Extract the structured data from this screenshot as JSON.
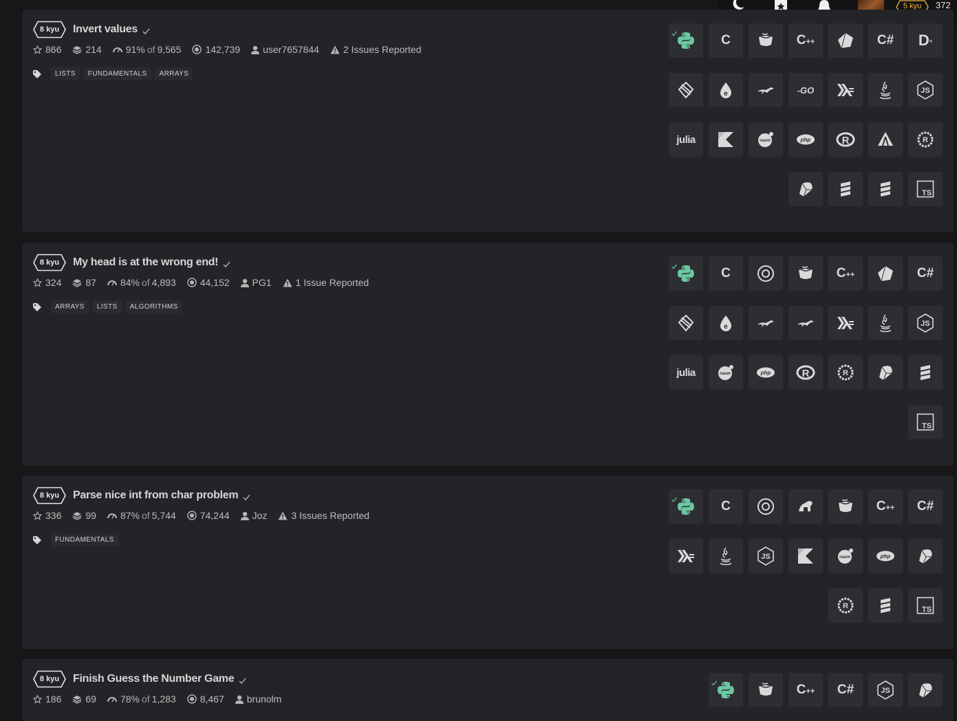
{
  "header": {
    "rank": "5 kyu",
    "honor": "372",
    "icons": [
      "moon-icon",
      "bookmark-icon",
      "bell-icon"
    ]
  },
  "colors": {
    "python": "#6cc7a2",
    "rank": "#e8b83a",
    "card": "#232427",
    "tile": "#2d2e32"
  },
  "katas": [
    {
      "rank": "8 kyu",
      "title": "Invert values",
      "stars": "866",
      "collections": "214",
      "satisfaction": "91%",
      "of": "of",
      "votes": "9,565",
      "completions": "142,739",
      "author": "user7657844",
      "issues": "2 Issues Reported",
      "tags": [
        "LISTS",
        "FUNDAMENTALS",
        "ARRAYS"
      ],
      "languages": [
        "python",
        "c",
        "coffeescript",
        "cpp",
        "crystal",
        "csharp",
        "dart",
        "elixir",
        "elm",
        "factor",
        "go",
        "haskell",
        "java",
        "javascript",
        "julia",
        "kotlin",
        "nasm",
        "php",
        "racket",
        "reason",
        "rust",
        "ruby",
        "scala",
        "solidity",
        "typescript"
      ]
    },
    {
      "rank": "8 kyu",
      "title": "My head is at the wrong end!",
      "stars": "324",
      "collections": "87",
      "satisfaction": "84%",
      "of": "of",
      "votes": "4,893",
      "completions": "44,152",
      "author": "PG1",
      "issues": "1 Issue Reported",
      "tags": [
        "ARRAYS",
        "LISTS",
        "ALGORITHMS"
      ],
      "languages": [
        "python",
        "c",
        "clojure",
        "coffeescript",
        "cpp",
        "crystal",
        "csharp",
        "elixir",
        "elm",
        "factor",
        "factor",
        "haskell",
        "java",
        "javascript",
        "julia",
        "nasm",
        "php",
        "racket",
        "rust",
        "ruby",
        "solidity",
        "typescript"
      ]
    },
    {
      "rank": "8 kyu",
      "title": "Parse nice int from char problem",
      "stars": "336",
      "collections": "99",
      "satisfaction": "87%",
      "of": "of",
      "votes": "5,744",
      "completions": "74,244",
      "author": "Joz",
      "issues": "3 Issues Reported",
      "tags": [
        "FUNDAMENTALS"
      ],
      "languages": [
        "python",
        "c",
        "clojure",
        "cfml",
        "coffeescript",
        "cpp",
        "csharp",
        "haskell",
        "java",
        "javascript",
        "kotlin",
        "nasm",
        "php",
        "ruby",
        "rust",
        "solidity",
        "typescript"
      ]
    },
    {
      "rank": "8 kyu",
      "title": "Finish Guess the Number Game",
      "stars": "186",
      "collections": "69",
      "satisfaction": "78%",
      "of": "of",
      "votes": "1,283",
      "completions": "8,467",
      "author": "brunolm",
      "issues": "",
      "tags": [],
      "languages": [
        "python",
        "coffeescript",
        "cpp",
        "csharp",
        "javascript",
        "ruby"
      ]
    }
  ]
}
